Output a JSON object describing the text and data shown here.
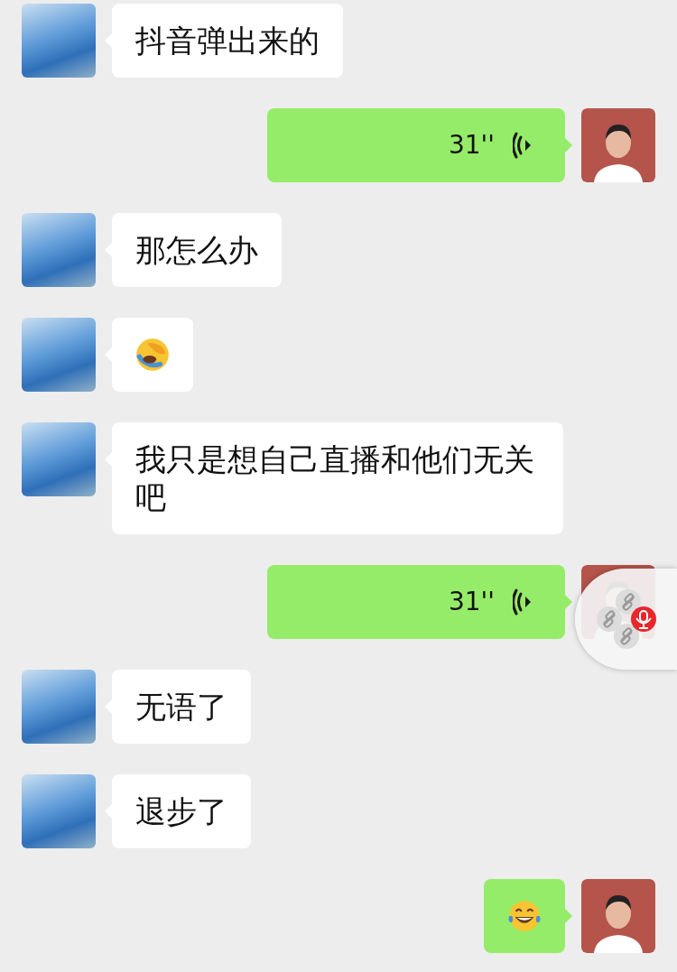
{
  "messages": [
    {
      "outgoing": false,
      "kind": "text",
      "text": "抖音弹出来的"
    },
    {
      "outgoing": true,
      "kind": "voice",
      "duration": "31''"
    },
    {
      "outgoing": false,
      "kind": "text",
      "text": "那怎么办"
    },
    {
      "outgoing": false,
      "kind": "facepalm"
    },
    {
      "outgoing": false,
      "kind": "text",
      "text": "我只是想自己直播和他们无关吧"
    },
    {
      "outgoing": true,
      "kind": "voice",
      "duration": "31''"
    },
    {
      "outgoing": false,
      "kind": "text",
      "text": "无语了"
    },
    {
      "outgoing": false,
      "kind": "text",
      "text": "退步了"
    },
    {
      "outgoing": true,
      "kind": "joy"
    }
  ]
}
